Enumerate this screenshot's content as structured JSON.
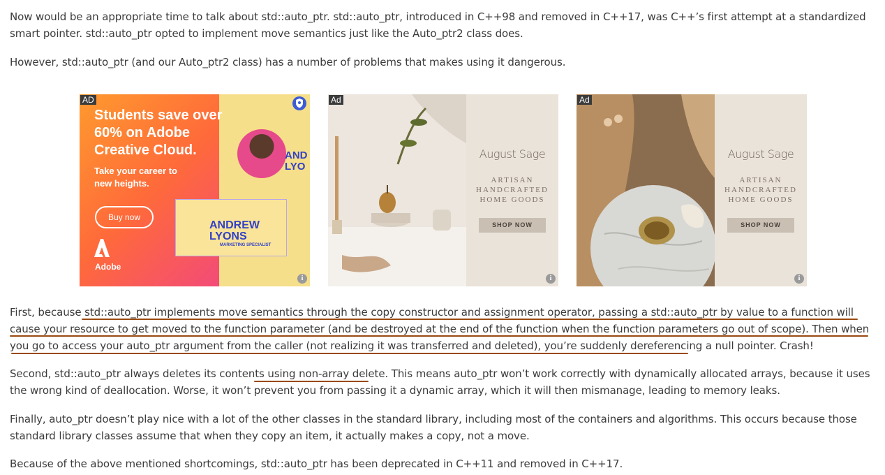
{
  "article": {
    "p1": "Now would be an appropriate time to talk about std::auto_ptr. std::auto_ptr, introduced in C++98 and removed in C++17, was C++’s first attempt at a standardized smart pointer. std::auto_ptr opted to implement move semantics just like the Auto_ptr2 class does.",
    "p2": "However, std::auto_ptr (and our Auto_ptr2 class) has a number of problems that makes using it dangerous.",
    "p3": "First, because std::auto_ptr implements move semantics through the copy constructor and assignment operator, passing a std::auto_ptr by value to a function will cause your resource to get moved to the function parameter (and be destroyed at the end of the function when the function parameters go out of scope). Then when you go to access your auto_ptr argument from the caller (not realizing it was transferred and deleted), you’re suddenly dereferencing a null pointer. Crash!",
    "p4_before": "Second, std::auto_ptr always deletes its contents ",
    "p4_highlight": "using non-array delete",
    "p4_after": ". This means auto_ptr won’t work correctly with dynamically allocated arrays, because it uses the wrong kind of deallocation. Worse, it won’t prevent you from passing it a dynamic array, which it will then mismanage, leading to memory leaks.",
    "p5": "Finally, auto_ptr doesn’t play nice with a lot of the other classes in the standard library, including most of the containers and algorithms. This occurs because those standard library classes assume that when they copy an item, it actually makes a copy, not a move.",
    "p6": "Because of the above mentioned shortcomings, std::auto_ptr has been deprecated in C++11 and removed in C++17."
  },
  "highlight_color": "#9a4a12",
  "ads": {
    "adobe": {
      "badge": "AD",
      "headline": "Students save over 60% on Adobe Creative Cloud.",
      "subtext": "Take your career to new heights.",
      "button": "Buy now",
      "logo_text": "Adobe",
      "card_name": "ANDREW LYONS",
      "card_role": "MARKETING SPECIALIST",
      "side_name": "AND LYO"
    },
    "sage1": {
      "badge": "Ad",
      "brand": "August Sage",
      "tagline": "ARTISAN HANDCRAFTED HOME GOODS",
      "button": "SHOP NOW"
    },
    "sage2": {
      "badge": "Ad",
      "brand": "August Sage",
      "tagline": "ARTISAN HANDCRAFTED HOME GOODS",
      "button": "SHOP NOW"
    }
  }
}
